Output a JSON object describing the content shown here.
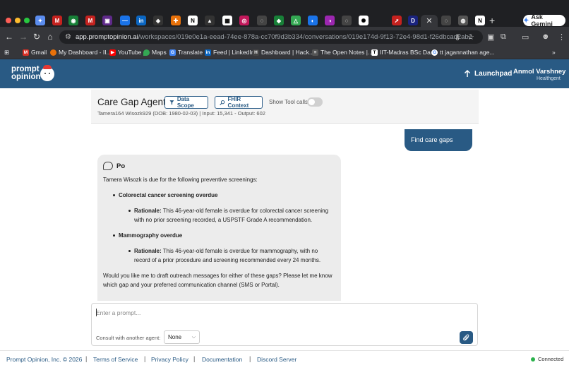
{
  "browser": {
    "active_tab_close": "✕",
    "new_tab": "+",
    "ask_gemini": "Ask Gemini",
    "url_host": "app.promptopinion.ai",
    "url_path": "/workspaces/019e0e1a-eead-74ee-878a-cc70f9d3b334/conversations/019e174d-9f13-72e4-98d1-f26dbcad2ab2",
    "bookmarks": [
      {
        "label": "Gmail",
        "icon": "gmail-icon",
        "color": "#d93025"
      },
      {
        "label": "My Dashboard - II...",
        "icon": "dashboard-icon",
        "color": "#e8710a"
      },
      {
        "label": "YouTube",
        "icon": "youtube-icon",
        "color": "#ff0000"
      },
      {
        "label": "Maps",
        "icon": "maps-icon",
        "color": "#34a853"
      },
      {
        "label": "Translate",
        "icon": "translate-icon",
        "color": "#4285f4"
      },
      {
        "label": "Feed | LinkedIn",
        "icon": "linkedin-icon",
        "color": "#0a66c2"
      },
      {
        "label": "Dashboard | Hack...",
        "icon": "hack-icon",
        "color": "#444444"
      },
      {
        "label": "The Open Notes |...",
        "icon": "notes-icon",
        "color": "#555555"
      },
      {
        "label": "IIT-Madras BSc Da...",
        "icon": "iitm-icon",
        "color": "#ffffff"
      },
      {
        "label": "tt jagannathan age...",
        "icon": "google-icon",
        "color": "#4285f4"
      }
    ],
    "bookmarks_more": "»"
  },
  "app": {
    "logo_line1": "prompt",
    "logo_line2": "opinion",
    "launchpad": "Launchpad",
    "user_name": "Anmol Varshney",
    "user_org": "Healthgent"
  },
  "agent": {
    "title": "Care Gap Agent",
    "data_scope": "Data Scope",
    "fhir_context": "FHIR Context",
    "show_tool_calls": "Show Tool calls",
    "show_tool_calls_on": false,
    "patient_meta": "Tamera164 Wisozk929 (DOB: 1980-02-03)",
    "token_meta": "| Input: 15,341 - Output: 602"
  },
  "chat": {
    "user_message": "Find care gaps",
    "assistant_name": "Po",
    "intro": "Tamera Wisozk is due for the following preventive screenings:",
    "gaps": [
      {
        "title": "Colorectal cancer screening overdue",
        "rationale_label": "Rationale:",
        "rationale_text": "This 46-year-old female is overdue for colorectal cancer screening with no prior screening recorded, a USPSTF Grade A recommendation."
      },
      {
        "title": "Mammography overdue",
        "rationale_label": "Rationale:",
        "rationale_text": "This 46-year-old female is overdue for mammography, with no record of a prior procedure and screening recommended every 24 months."
      }
    ],
    "followup": "Would you like me to draft outreach messages for either of these gaps? Please let me know which gap and your preferred communication channel (SMS or Portal)."
  },
  "prompt": {
    "placeholder": "Enter a prompt...",
    "consult_label": "Consult with another agent:",
    "consult_value": "None"
  },
  "footer": {
    "copyright": "Prompt Opinion, Inc. © 2026",
    "terms": "Terms of Service",
    "privacy": "Privacy Policy",
    "docs": "Documentation",
    "discord": "Discord Server",
    "separator": "|",
    "status": "Connected",
    "status_color": "#2bb24c"
  }
}
